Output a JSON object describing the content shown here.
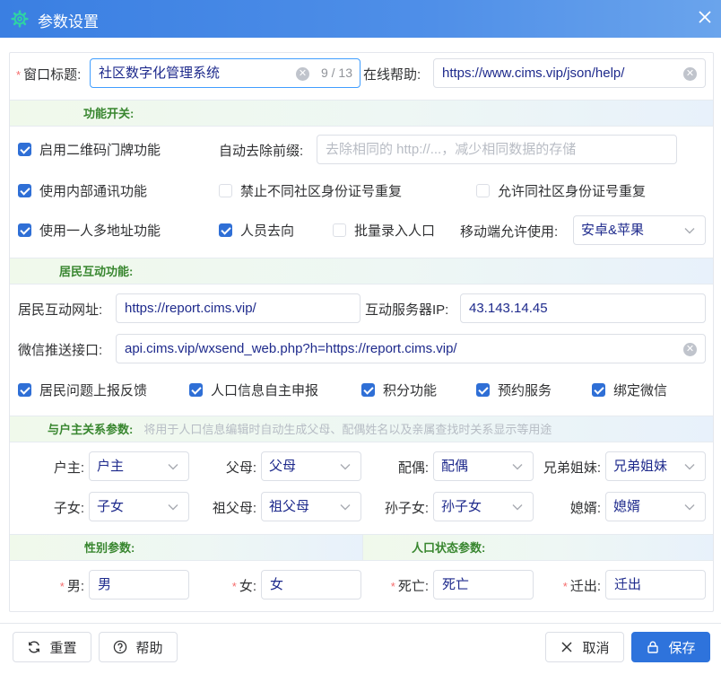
{
  "dialog": {
    "title": "参数设置",
    "gear_icon": "gear-icon",
    "close_icon": "close-icon"
  },
  "header": {
    "window_title_label": "窗口标题:",
    "window_title_value": "社区数字化管理系统",
    "window_title_count": "9 / 13",
    "help_label": "在线帮助:",
    "help_value": "https://www.cims.vip/json/help/"
  },
  "feature_section": {
    "title": "功能开关:",
    "qr_label": "启用二维码门牌功能",
    "prefix_label": "自动去除前缀:",
    "prefix_placeholder": "去除相同的 http://...，减少相同数据的存储",
    "internal_comm_label": "使用内部通讯功能",
    "forbid_dup_id_label": "禁止不同社区身份证号重复",
    "allow_dup_id_label": "允许同社区身份证号重复",
    "multi_address_label": "使用一人多地址功能",
    "person_direction_label": "人员去向",
    "batch_entry_label": "批量录入人口",
    "mobile_label": "移动端允许使用:",
    "mobile_value": "安卓&苹果"
  },
  "interaction_section": {
    "title": "居民互动功能:",
    "url_label": "居民互动网址:",
    "url_value": "https://report.cims.vip/",
    "server_ip_label": "互动服务器IP:",
    "server_ip_value": "43.143.14.45",
    "wechat_label": "微信推送接口:",
    "wechat_value": "api.cims.vip/wxsend_web.php?h=https://report.cims.vip/",
    "checks": [
      "居民问题上报反馈",
      "人口信息自主申报",
      "积分功能",
      "预约服务",
      "绑定微信"
    ]
  },
  "relation_section": {
    "title": "与户主关系参数:",
    "note": "将用于人口信息编辑时自动生成父母、配偶姓名以及亲属查找时关系显示等用途",
    "fields": [
      {
        "label": "户主:",
        "value": "户主"
      },
      {
        "label": "父母:",
        "value": "父母"
      },
      {
        "label": "配偶:",
        "value": "配偶"
      },
      {
        "label": "兄弟姐妹:",
        "value": "兄弟姐妹"
      },
      {
        "label": "子女:",
        "value": "子女"
      },
      {
        "label": "祖父母:",
        "value": "祖父母"
      },
      {
        "label": "孙子女:",
        "value": "孙子女"
      },
      {
        "label": "媳婿:",
        "value": "媳婿"
      }
    ]
  },
  "gender_section": {
    "title": "性别参数:",
    "male_label": "男:",
    "male_value": "男",
    "female_label": "女:",
    "female_value": "女"
  },
  "status_section": {
    "title": "人口状态参数:",
    "dead_label": "死亡:",
    "dead_value": "死亡",
    "moved_label": "迁出:",
    "moved_value": "迁出"
  },
  "footer": {
    "reset_label": "重置",
    "help_label": "帮助",
    "cancel_label": "取消",
    "save_label": "保存"
  },
  "colors": {
    "title_bar": "#3a7fe2",
    "accent": "#2e73dc",
    "section_text": "#38862f",
    "required": "#f56c6c",
    "value_text": "#1e2a8c"
  }
}
